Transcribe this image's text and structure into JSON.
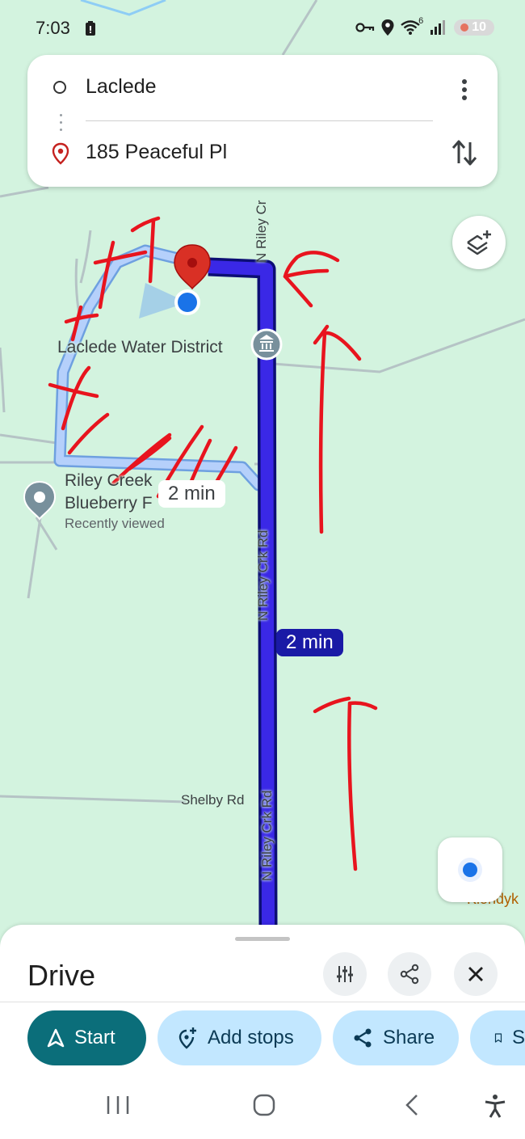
{
  "status_bar": {
    "time": "7:03",
    "signal_superscript": "6",
    "battery": "10"
  },
  "directions": {
    "origin": "Laclede",
    "destination": "185 Peaceful Pl"
  },
  "map": {
    "labels": {
      "water_district": "Laclede Water District",
      "riley_creek_line1": "Riley Creek",
      "riley_creek_line2": "Blueberry F",
      "recently_viewed": "Recently viewed",
      "road_top": "N Riley Cr",
      "road_mid": "N Riley Crk Rd",
      "road_bottom": "N Riley Crk Rd",
      "shelby": "Shelby Rd",
      "klondyke": "Klondyk"
    },
    "route_primary_time": "2 min",
    "route_alt_time": "2 min",
    "colors": {
      "route_primary": "#2a1fdb",
      "route_alt": "#a8c7fa",
      "annotation": "#e8141e",
      "land": "#d3f3df"
    }
  },
  "sheet": {
    "title": "Drive",
    "buttons": {
      "start": "Start",
      "add_stops": "Add stops",
      "share": "Share",
      "save": "S"
    }
  },
  "icons": [
    "radio-circle-icon",
    "location-pin-icon",
    "more-vert-icon",
    "swap-icon",
    "layers-icon",
    "my-location-icon",
    "tune-icon",
    "share-icon",
    "close-icon",
    "navigation-arrow-icon",
    "add-location-icon",
    "bookmark-icon",
    "recents-icon",
    "home-icon",
    "back-icon",
    "accessibility-icon"
  ]
}
